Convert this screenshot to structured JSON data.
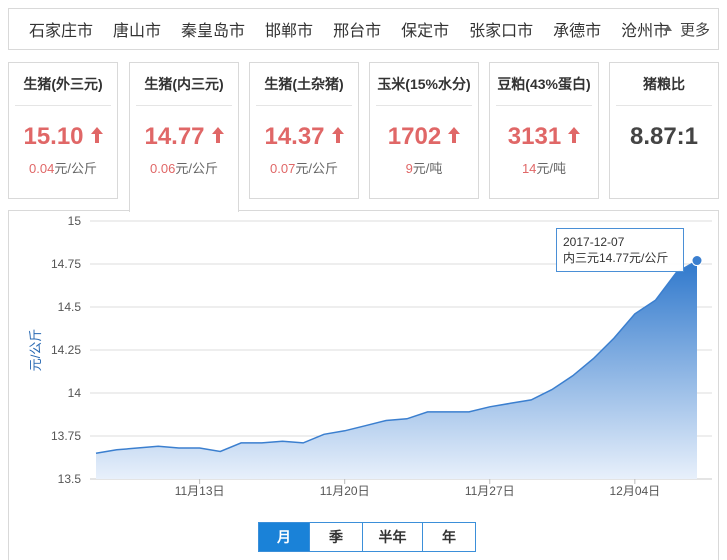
{
  "cities": [
    "石家庄市",
    "唐山市",
    "秦皇岛市",
    "邯郸市",
    "邢台市",
    "保定市",
    "张家口市",
    "承德市",
    "沧州市"
  ],
  "more_label": "更多",
  "cards": [
    {
      "title": "生猪(外三元)",
      "price": "15.10",
      "change": "0.04",
      "unit": "元/公斤"
    },
    {
      "title": "生猪(内三元)",
      "price": "14.77",
      "change": "0.06",
      "unit": "元/公斤"
    },
    {
      "title": "生猪(土杂猪)",
      "price": "14.37",
      "change": "0.07",
      "unit": "元/公斤"
    },
    {
      "title": "玉米(15%水分)",
      "price": "1702",
      "change": "9",
      "unit": "元/吨"
    },
    {
      "title": "豆粕(43%蛋白)",
      "price": "3131",
      "change": "14",
      "unit": "元/吨"
    },
    {
      "title": "猪粮比",
      "price": "8.87:1"
    }
  ],
  "colors": {
    "up": "#e06767",
    "accent": "#1a82d8",
    "line": "#3b7fcf"
  },
  "chart_data": {
    "type": "area",
    "ylabel": "元/公斤",
    "ylim": [
      13.5,
      15
    ],
    "y_ticks": [
      "15",
      "14.75",
      "14.5",
      "14.25",
      "14",
      "13.75",
      "13.5"
    ],
    "x_ticks": [
      "11月13日",
      "11月20日",
      "11月27日",
      "12月04日"
    ],
    "dates": [
      "2017-11-08",
      "2017-11-09",
      "2017-11-10",
      "2017-11-11",
      "2017-11-12",
      "2017-11-13",
      "2017-11-14",
      "2017-11-15",
      "2017-11-16",
      "2017-11-17",
      "2017-11-18",
      "2017-11-19",
      "2017-11-20",
      "2017-11-21",
      "2017-11-22",
      "2017-11-23",
      "2017-11-24",
      "2017-11-25",
      "2017-11-26",
      "2017-11-27",
      "2017-11-28",
      "2017-11-29",
      "2017-11-30",
      "2017-12-01",
      "2017-12-02",
      "2017-12-03",
      "2017-12-04",
      "2017-12-05",
      "2017-12-06",
      "2017-12-07"
    ],
    "values": [
      13.65,
      13.67,
      13.68,
      13.69,
      13.68,
      13.68,
      13.66,
      13.71,
      13.71,
      13.72,
      13.71,
      13.76,
      13.78,
      13.81,
      13.84,
      13.85,
      13.89,
      13.89,
      13.89,
      13.92,
      13.94,
      13.96,
      14.02,
      14.1,
      14.2,
      14.32,
      14.46,
      14.54,
      14.7,
      14.77
    ],
    "tooltip": {
      "date": "2017-12-07",
      "text": "内三元14.77元/公斤"
    }
  },
  "periods": [
    "月",
    "季",
    "半年",
    "年"
  ]
}
